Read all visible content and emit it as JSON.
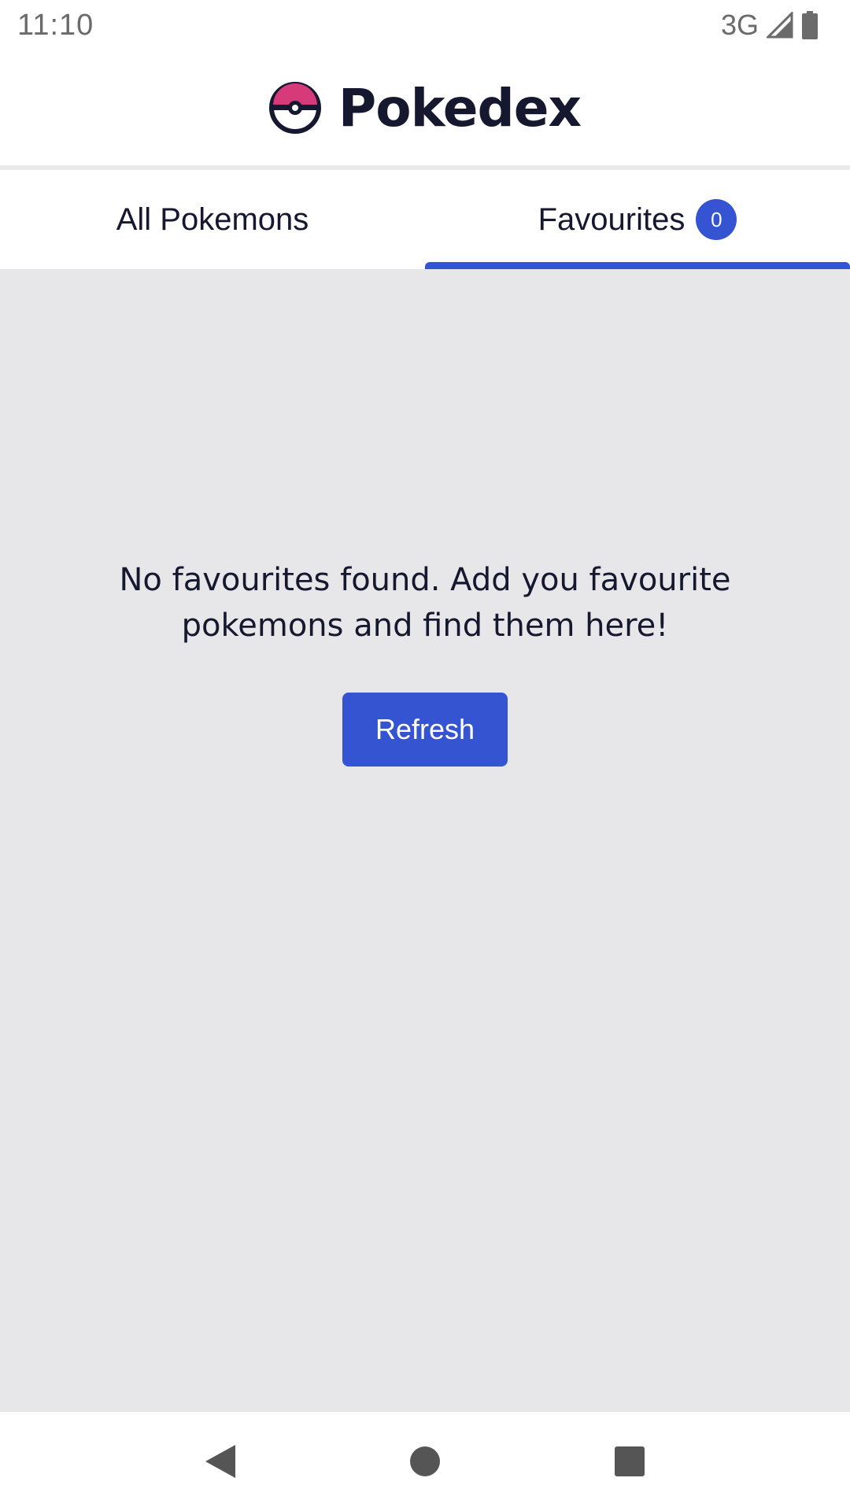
{
  "status_bar": {
    "time": "11:10",
    "network": "3G",
    "icons": [
      "signal-icon",
      "battery-icon"
    ]
  },
  "header": {
    "title": "Pokedex",
    "logo_icon": "pokeball-icon"
  },
  "tabs": [
    {
      "label": "All Pokemons",
      "active": false
    },
    {
      "label": "Favourites",
      "badge": "0",
      "active": true
    }
  ],
  "empty_state": {
    "message": "No favourites found. Add you favourite pokemons and find them here!",
    "button_label": "Refresh"
  },
  "nav_bar": {
    "buttons": [
      "back-icon",
      "home-icon",
      "recents-icon"
    ]
  },
  "colors": {
    "accent": "#3454d1",
    "title_text": "#15182e",
    "content_bg": "#e7e7e9",
    "pokeball_top": "#d63a78"
  }
}
